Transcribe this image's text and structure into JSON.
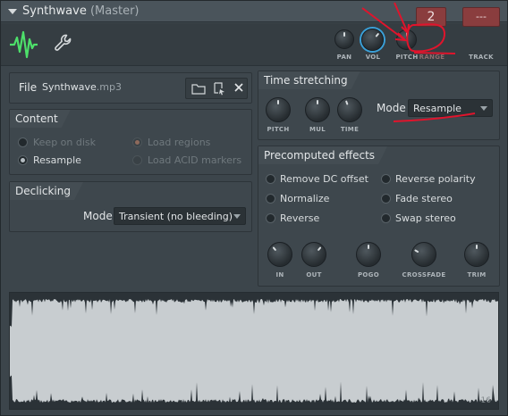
{
  "window": {
    "title": "Synthwave",
    "subtitle": "(Master)",
    "close_glyph": "✕"
  },
  "toolbar": {
    "wave_icon": "waveform-icon",
    "settings_icon": "wrench-icon",
    "knobs": [
      {
        "label": "PAN"
      },
      {
        "label": "VOL"
      },
      {
        "label": "PITCH"
      }
    ],
    "range_label": "RANGE",
    "range_value": "2",
    "track_label": "TRACK",
    "track_value": "---",
    "accent_color": "#3aa0d8",
    "box_color": "#8a3d3e"
  },
  "file": {
    "label": "File",
    "name": "Synthwave",
    "ext": ".mp3",
    "open_icon": "folder-icon",
    "locate_icon": "locate-file-icon",
    "clear_icon": "close-icon"
  },
  "content": {
    "header": "Content",
    "options": [
      {
        "label": "Keep on disk",
        "enabled": false,
        "checked": false
      },
      {
        "label": "Resample",
        "enabled": true,
        "checked": true
      },
      {
        "label": "Load regions",
        "enabled": false,
        "checked": true
      },
      {
        "label": "Load ACID markers",
        "enabled": false,
        "checked": false
      }
    ]
  },
  "declicking": {
    "header": "Declicking",
    "mode_label": "Mode",
    "mode_value": "Transient (no bleeding)"
  },
  "time_stretching": {
    "header": "Time stretching",
    "knobs": [
      "PITCH",
      "MUL",
      "TIME"
    ],
    "mode_label": "Mode",
    "mode_value": "Resample"
  },
  "precomputed": {
    "header": "Precomputed effects",
    "left": [
      "Remove DC offset",
      "Normalize",
      "Reverse"
    ],
    "right": [
      "Reverse polarity",
      "Fade stereo",
      "Swap stereo"
    ],
    "knobs": [
      "IN",
      "OUT",
      "POGO",
      "CROSSFADE",
      "TRIM"
    ]
  },
  "waveform": {
    "count": "16",
    "color": "#c8cdd0"
  },
  "annotations": {
    "color": "#e0142c"
  }
}
